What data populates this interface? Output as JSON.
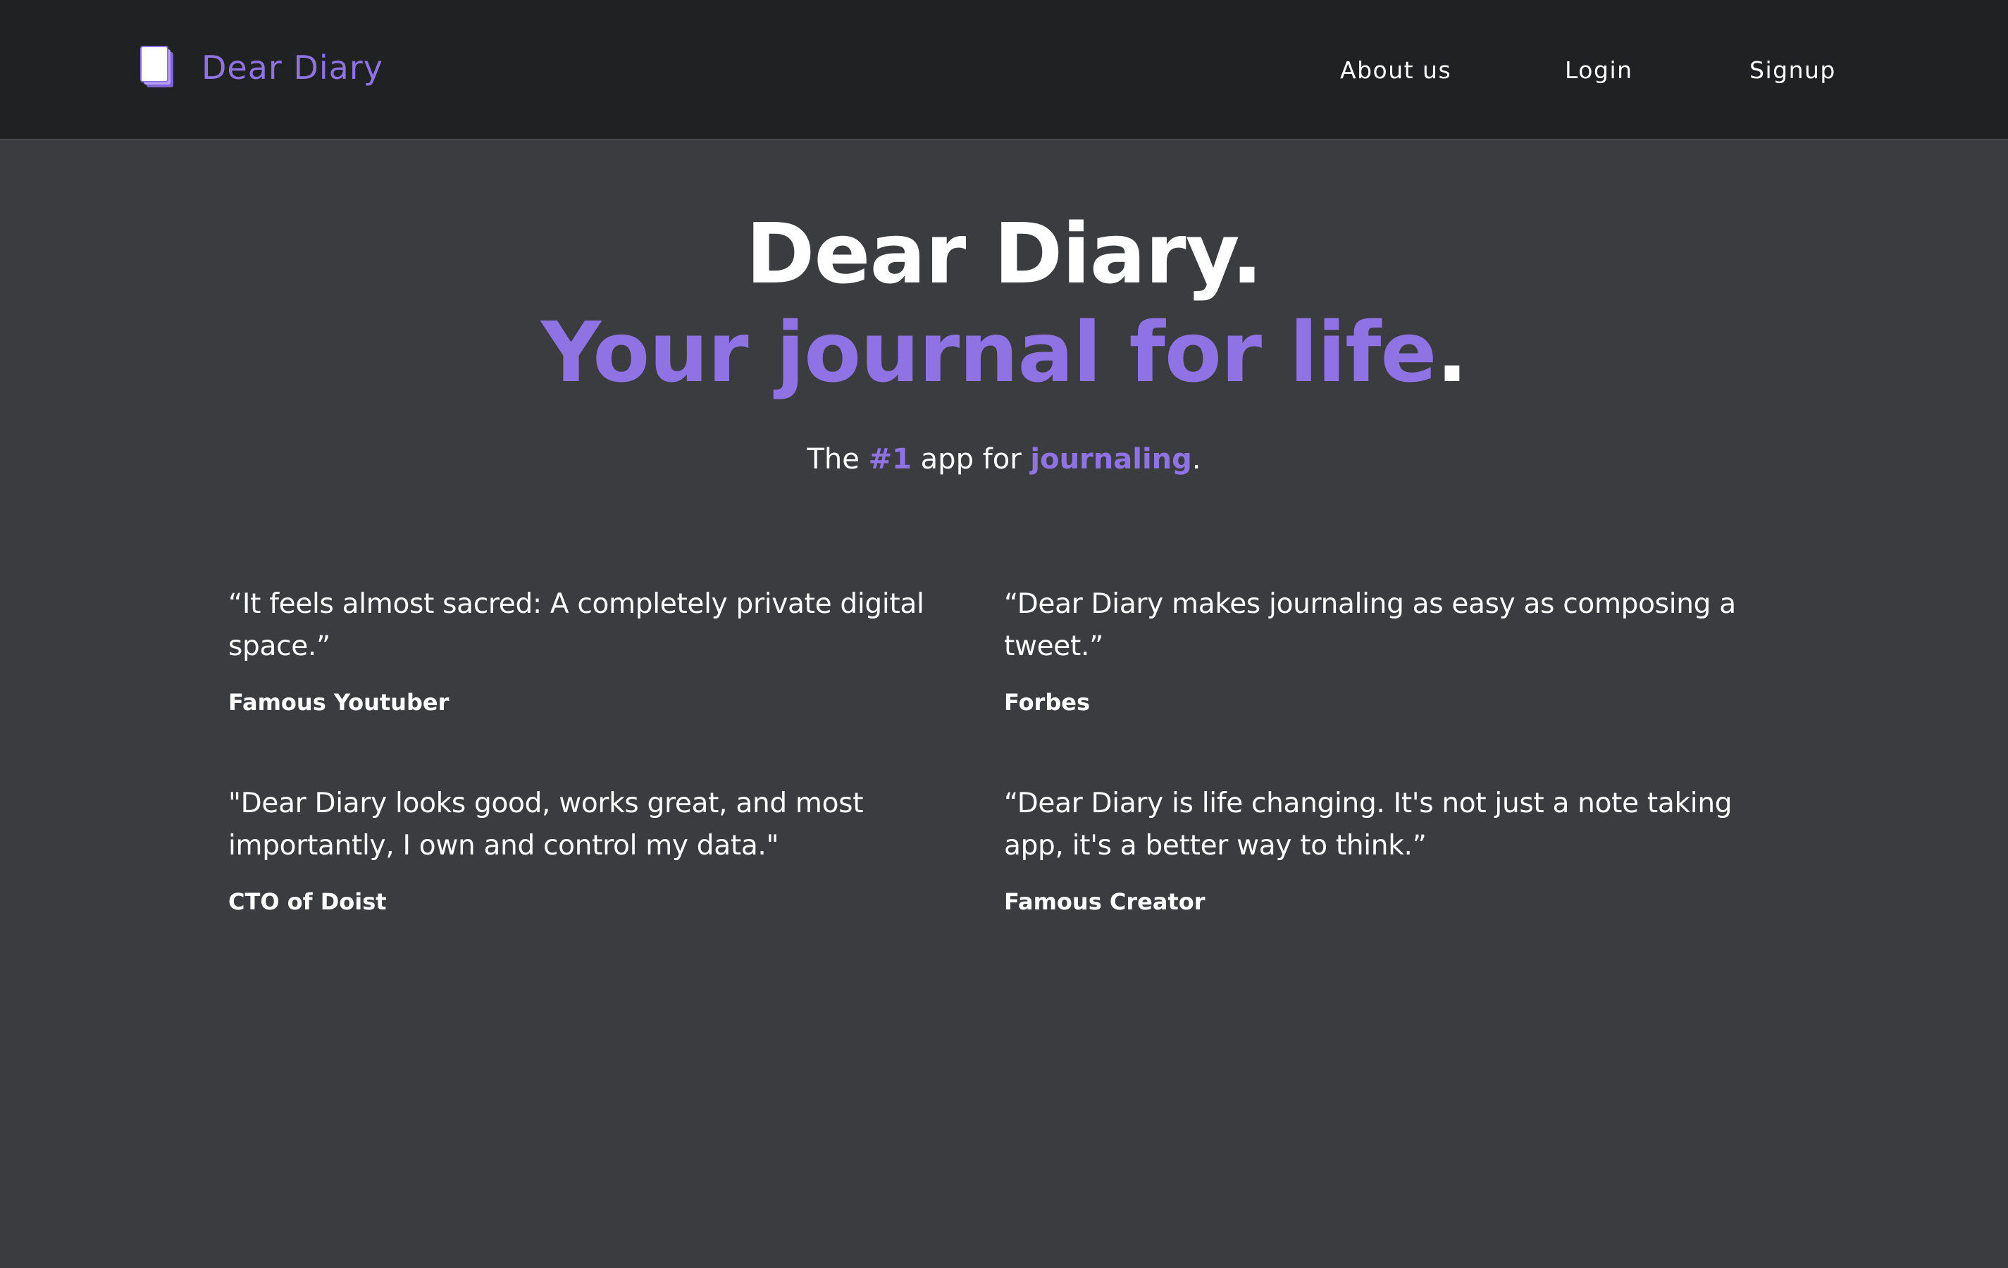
{
  "nav": {
    "brand": "Dear Diary",
    "links": [
      {
        "label": "About us"
      },
      {
        "label": "Login"
      },
      {
        "label": "Signup"
      }
    ]
  },
  "hero": {
    "title": "Dear Diary.",
    "tagline": "Your journal for life",
    "tagline_end": ".",
    "sub": {
      "prefix": "The ",
      "highlight1": "#1",
      "middle": " app for ",
      "highlight2": "journaling",
      "suffix": "."
    }
  },
  "testimonials": [
    {
      "quote": "“It feels almost sacred: A completely private digital space.”",
      "author": "Famous Youtuber"
    },
    {
      "quote": "“Dear Diary makes journaling as easy as composing a tweet.”",
      "author": "Forbes"
    },
    {
      "quote": "\"Dear Diary looks good, works great, and most importantly, I own and control my data.\"",
      "author": "CTO of Doist"
    },
    {
      "quote": "“Dear Diary is life changing. It's not just a note taking app, it's a better way to think.”",
      "author": "Famous Creator"
    }
  ],
  "colors": {
    "accent": "#8f72e4",
    "background": "#3b3c3f",
    "navbar": "#202122",
    "text": "#ffffff"
  },
  "icons": {
    "brand": "notebook-icon"
  }
}
